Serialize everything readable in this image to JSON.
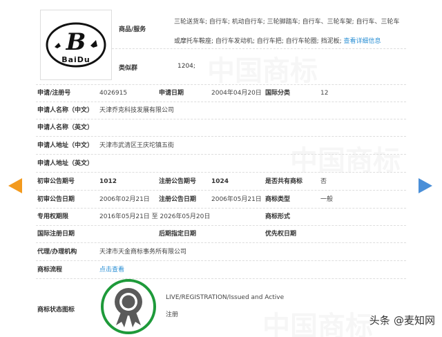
{
  "top": {
    "goods_label": "商品/服务",
    "goods_text": "三轮送货车; 自行车; 机动自行车; 三轮脚踏车; 自行车、三轮车架; 自行车、三轮车或摩托车鞍座; 自行车发动机; 自行车把; 自行车轮圈; 挡泥板; ",
    "goods_more": "查看详细信息",
    "similar_label": "类似群",
    "similar_value": "1204;"
  },
  "logo": {
    "letter": "B",
    "word": "BaiDu"
  },
  "rows": {
    "app_no_label": "申请/注册号",
    "app_no": "4026915",
    "app_date_label": "申请日期",
    "app_date": "2004年04月20日",
    "intl_class_label": "国际分类",
    "intl_class": "12",
    "applicant_cn_label": "申请人名称（中文）",
    "applicant_cn": "天津乔克科技发展有限公司",
    "applicant_en_label": "申请人名称（英文）",
    "address_cn_label": "申请人地址（中文）",
    "address_cn": "天津市武清区王庆坨镇五街",
    "address_en_label": "申请人地址（英文）",
    "prelim_no_label": "初审公告期号",
    "prelim_no": "1012",
    "reg_pub_no_label": "注册公告期号",
    "reg_pub_no": "1024",
    "shared_label": "是否共有商标",
    "shared": "否",
    "prelim_date_label": "初审公告日期",
    "prelim_date": "2006年02月21日",
    "reg_pub_date_label": "注册公告日期",
    "reg_pub_date": "2006年05月21日",
    "tm_type_label": "商标类型",
    "tm_type": "一般",
    "exclusive_label": "专用权期限",
    "exclusive": "2016年05月21日 至 2026年05月20日",
    "tm_form_label": "商标形式",
    "intl_reg_label": "国际注册日期",
    "later_date_label": "后期指定日期",
    "priority_label": "优先权日期",
    "agent_label": "代理/办理机构",
    "agent": "天津市天金商标事务所有限公司",
    "flow_label": "商标流程",
    "flow_link": "点击查看"
  },
  "status": {
    "label": "商标状态图标",
    "line1": "LIVE/REGISTRATION/Issued and Active",
    "line2": "注册"
  },
  "corner": {
    "prefix": "头条",
    "handle": "@麦知网"
  },
  "watermark": "中国商标",
  "colors": {
    "link": "#2a8fd4",
    "arrow_left": "#f39a1d",
    "arrow_right": "#4a8fd8",
    "seal_ring": "#1e9a3a"
  }
}
